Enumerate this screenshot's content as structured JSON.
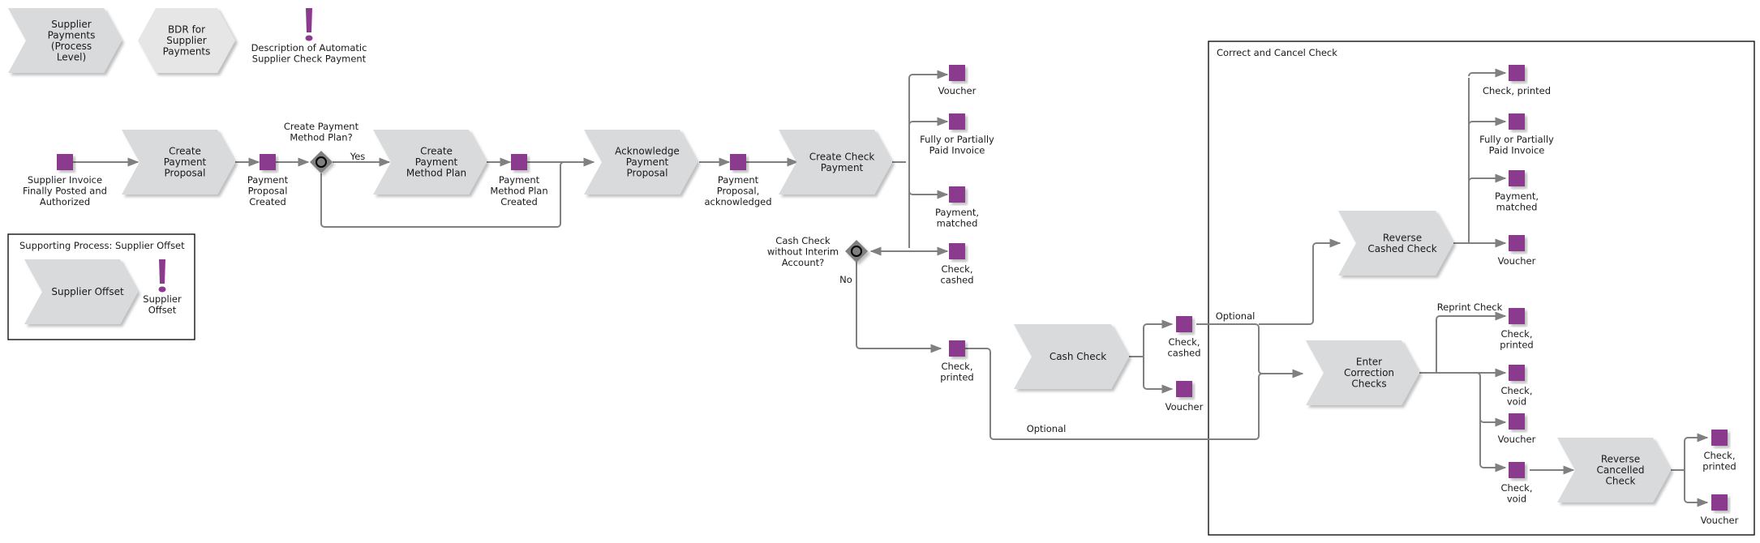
{
  "colors": {
    "function_fill": "#d9dadc",
    "function_fill_light": "#e6e6e6",
    "event_fill": "#8a3b8e",
    "edge": "#808080",
    "gateway_fill": "#7f7f7f",
    "text": "#1a1a1a"
  },
  "legend": {
    "process_level": "Supplier Payments (Process Level)",
    "bdr": "BDR for Supplier Payments",
    "description_note": "Description of Automatic Supplier Check Payment"
  },
  "supporting_process": {
    "title": "Supporting Process: Supplier Offset",
    "function": "Supplier Offset",
    "note": "Supplier Offset"
  },
  "main_flow": {
    "start_event": "Supplier Invoice Finally Posted and Authorized",
    "create_payment_proposal": "Create Payment Proposal",
    "payment_proposal_created": "Payment Proposal Created",
    "gateway_plan_question": "Create Payment Method Plan?",
    "yes_label": "Yes",
    "create_payment_method_plan": "Create Payment Method Plan",
    "payment_method_plan_created": "Payment Method Plan Created",
    "acknowledge_payment_proposal": "Acknowledge Payment Proposal",
    "payment_proposal_acknowledged": "Payment Proposal, acknowledged",
    "create_check_payment": "Create Check Payment",
    "outputs": [
      "Voucher",
      "Fully or Partially Paid Invoice",
      "Payment, matched",
      "Check, cashed"
    ],
    "gateway_cash_question": "Cash Check without Interim Account?",
    "no_label": "No",
    "check_printed": "Check, printed",
    "cash_check": "Cash Check",
    "cash_outputs": [
      "Check, cashed",
      "Voucher"
    ],
    "optional_label_bottom": "Optional",
    "optional_label_top": "Optional"
  },
  "correct_cancel": {
    "title": "Correct and Cancel Check",
    "reverse_cashed_check": "Reverse Cashed Check",
    "reverse_outputs": [
      "Check, printed",
      "Fully or Partially Paid Invoice",
      "Payment, matched",
      "Voucher"
    ],
    "enter_correction_checks": "Enter Correction Checks",
    "reprint_label": "Reprint Check",
    "correction_outputs": [
      "Check, printed",
      "Check, void",
      "Voucher",
      "Check, void"
    ],
    "reverse_cancelled_check": "Reverse Cancelled Check",
    "cancelled_outputs": [
      "Check, printed",
      "Voucher"
    ]
  }
}
